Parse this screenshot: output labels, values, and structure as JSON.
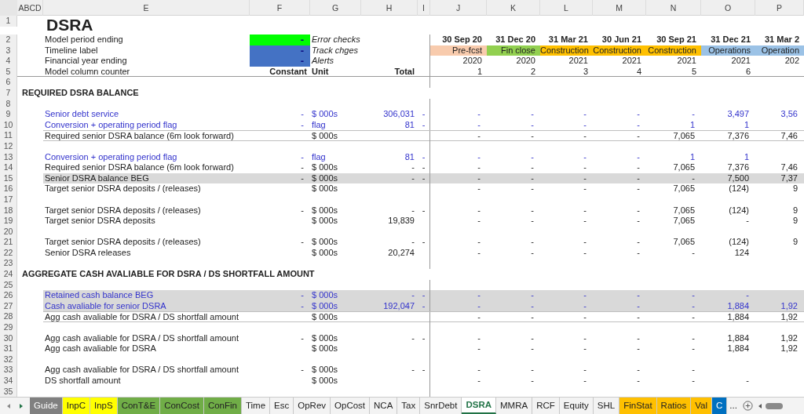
{
  "column_headers": [
    "ABCD",
    "E",
    "F",
    "G",
    "H",
    "I",
    "J",
    "K",
    "L",
    "M",
    "N",
    "O",
    "P"
  ],
  "title": {
    "row": "1",
    "text": "DSRA"
  },
  "meta_rows": [
    {
      "row": "2",
      "label": "Model period ending",
      "swatch": "-",
      "color": "#00ff00",
      "note": "Error checks"
    },
    {
      "row": "3",
      "label": "Timeline label",
      "swatch": "-",
      "color": "#4472c4",
      "note": "Track chges"
    },
    {
      "row": "4",
      "label": "Financial year ending",
      "swatch": "-",
      "color": "#4472c4",
      "note": "Alerts"
    }
  ],
  "periods": [
    {
      "date": "30 Sep 20",
      "phase": "Pre-fcst",
      "color": "#f8cbad",
      "year": "2020",
      "counter": "1"
    },
    {
      "date": "31 Dec 20",
      "phase": "Fin close",
      "color": "#92d050",
      "year": "2020",
      "counter": "2"
    },
    {
      "date": "31 Mar 21",
      "phase": "Construction",
      "color": "#ffc000",
      "year": "2021",
      "counter": "3"
    },
    {
      "date": "30 Jun 21",
      "phase": "Construction",
      "color": "#ffc000",
      "year": "2021",
      "counter": "4"
    },
    {
      "date": "30 Sep 21",
      "phase": "Construction",
      "color": "#ffc000",
      "year": "2021",
      "counter": "5"
    },
    {
      "date": "31 Dec 21",
      "phase": "Operations",
      "color": "#9bc2e6",
      "year": "2021",
      "counter": "6"
    },
    {
      "date": "31 Mar 2",
      "phase": "Operation",
      "color": "#9bc2e6",
      "year": "202"
    }
  ],
  "counter_row": {
    "row": "5",
    "label": "Model column counter",
    "constant": "Constant",
    "unit": "Unit",
    "total": "Total"
  },
  "rows": [
    {
      "row": "6",
      "kind": "blank"
    },
    {
      "row": "7",
      "kind": "section",
      "label": "REQUIRED DSRA BALANCE"
    },
    {
      "row": "8",
      "kind": "blank"
    },
    {
      "row": "9",
      "kind": "data",
      "input": true,
      "shaded": false,
      "ruled": false,
      "label": "Senior debt service",
      "constant": "-",
      "unit": "$ 000s",
      "total": "306,031",
      "check": "-",
      "cells": [
        "-",
        "-",
        "-",
        "-",
        "-",
        "3,497",
        "3,56"
      ]
    },
    {
      "row": "10",
      "kind": "data",
      "input": true,
      "shaded": false,
      "ruled": false,
      "label": "Conversion + operating period flag",
      "constant": "-",
      "unit": "flag",
      "total": "81",
      "check": "-",
      "cells": [
        "-",
        "-",
        "-",
        "-",
        "1",
        "1",
        ""
      ]
    },
    {
      "row": "11",
      "kind": "data",
      "input": false,
      "shaded": false,
      "ruled": true,
      "label": "Required senior DSRA balance (6m look forward)",
      "constant": "",
      "unit": "$ 000s",
      "total": "",
      "check": "",
      "cells": [
        "-",
        "-",
        "-",
        "-",
        "7,065",
        "7,376",
        "7,46"
      ]
    },
    {
      "row": "12",
      "kind": "blank"
    },
    {
      "row": "13",
      "kind": "data",
      "input": true,
      "shaded": false,
      "ruled": false,
      "label": "Conversion + operating period flag",
      "constant": "-",
      "unit": "flag",
      "total": "81",
      "check": "-",
      "cells": [
        "-",
        "-",
        "-",
        "-",
        "1",
        "1",
        ""
      ]
    },
    {
      "row": "14",
      "kind": "data",
      "input": false,
      "shaded": false,
      "ruled": false,
      "label": "Required senior DSRA balance (6m look forward)",
      "constant": "-",
      "unit": "$ 000s",
      "total": "-",
      "check": "-",
      "cells": [
        "-",
        "-",
        "-",
        "-",
        "7,065",
        "7,376",
        "7,46"
      ]
    },
    {
      "row": "15",
      "kind": "data",
      "input": false,
      "shaded": true,
      "ruled": false,
      "label": "Senior DSRA balance BEG",
      "constant": "-",
      "unit": "$ 000s",
      "total": "-",
      "check": "-",
      "cells": [
        "-",
        "-",
        "-",
        "-",
        "-",
        "7,500",
        "7,37"
      ]
    },
    {
      "row": "16",
      "kind": "data",
      "input": false,
      "shaded": false,
      "ruled": false,
      "label": "Target senior DSRA deposits / (releases)",
      "constant": "",
      "unit": "$ 000s",
      "total": "",
      "check": "",
      "cells": [
        "-",
        "-",
        "-",
        "-",
        "7,065",
        "(124)",
        "9"
      ]
    },
    {
      "row": "17",
      "kind": "blank"
    },
    {
      "row": "18",
      "kind": "data",
      "input": false,
      "shaded": false,
      "ruled": false,
      "label": "Target senior DSRA deposits / (releases)",
      "constant": "-",
      "unit": "$ 000s",
      "total": "-",
      "check": "-",
      "cells": [
        "-",
        "-",
        "-",
        "-",
        "7,065",
        "(124)",
        "9"
      ]
    },
    {
      "row": "19",
      "kind": "data",
      "input": false,
      "shaded": false,
      "ruled": false,
      "label": "Target senior DSRA deposits",
      "constant": "",
      "unit": "$ 000s",
      "total": "19,839",
      "check": "",
      "cells": [
        "-",
        "-",
        "-",
        "-",
        "7,065",
        "-",
        "9"
      ]
    },
    {
      "row": "20",
      "kind": "blank"
    },
    {
      "row": "21",
      "kind": "data",
      "input": false,
      "shaded": false,
      "ruled": false,
      "label": "Target senior DSRA deposits / (releases)",
      "constant": "-",
      "unit": "$ 000s",
      "total": "-",
      "check": "-",
      "cells": [
        "-",
        "-",
        "-",
        "-",
        "7,065",
        "(124)",
        "9"
      ]
    },
    {
      "row": "22",
      "kind": "data",
      "input": false,
      "shaded": false,
      "ruled": false,
      "label": "Senior DSRA releases",
      "constant": "",
      "unit": "$ 000s",
      "total": "20,274",
      "check": "",
      "cells": [
        "-",
        "-",
        "-",
        "-",
        "-",
        "124",
        ""
      ]
    },
    {
      "row": "23",
      "kind": "blank"
    },
    {
      "row": "24",
      "kind": "section",
      "label": "AGGREGATE CASH AVALIABLE FOR DSRA / DS SHORTFALL AMOUNT"
    },
    {
      "row": "25",
      "kind": "blank"
    },
    {
      "row": "26",
      "kind": "data",
      "input": true,
      "shaded": true,
      "ruled": false,
      "label": "Retained cash balance BEG",
      "constant": "-",
      "unit": "$ 000s",
      "total": "-",
      "check": "-",
      "cells": [
        "-",
        "-",
        "-",
        "-",
        "-",
        "-",
        ""
      ]
    },
    {
      "row": "27",
      "kind": "data",
      "input": true,
      "shaded": true,
      "ruled": false,
      "label": "Cash avaliable for senior DSRA",
      "constant": "-",
      "unit": "$ 000s",
      "total": "192,047",
      "check": "-",
      "cells": [
        "-",
        "-",
        "-",
        "-",
        "-",
        "1,884",
        "1,92"
      ]
    },
    {
      "row": "28",
      "kind": "data",
      "input": false,
      "shaded": false,
      "ruled": true,
      "label": "Agg cash avaliable for DSRA / DS shortfall amount",
      "constant": "",
      "unit": "$ 000s",
      "total": "",
      "check": "",
      "cells": [
        "-",
        "-",
        "-",
        "-",
        "-",
        "1,884",
        "1,92"
      ]
    },
    {
      "row": "29",
      "kind": "blank"
    },
    {
      "row": "30",
      "kind": "data",
      "input": false,
      "shaded": false,
      "ruled": false,
      "label": "Agg cash avaliable for DSRA / DS shortfall amount",
      "constant": "-",
      "unit": "$ 000s",
      "total": "-",
      "check": "-",
      "cells": [
        "-",
        "-",
        "-",
        "-",
        "-",
        "1,884",
        "1,92"
      ]
    },
    {
      "row": "31",
      "kind": "data",
      "input": false,
      "shaded": false,
      "ruled": false,
      "label": "Agg cash avaliable for DSRA",
      "constant": "",
      "unit": "$ 000s",
      "total": "",
      "check": "",
      "cells": [
        "-",
        "-",
        "-",
        "-",
        "-",
        "1,884",
        "1,92"
      ]
    },
    {
      "row": "32",
      "kind": "blank"
    },
    {
      "row": "33",
      "kind": "data",
      "input": false,
      "shaded": false,
      "ruled": false,
      "label": "Agg cash avaliable for DSRA / DS shortfall amount",
      "constant": "-",
      "unit": "$ 000s",
      "total": "-",
      "check": "-",
      "cells": [
        "-",
        "-",
        "-",
        "-",
        "-",
        "",
        ""
      ]
    },
    {
      "row": "34",
      "kind": "data",
      "input": false,
      "shaded": false,
      "ruled": false,
      "label": "DS shortfall amount",
      "constant": "",
      "unit": "$ 000s",
      "total": "",
      "check": "",
      "cells": [
        "-",
        "-",
        "-",
        "-",
        "-",
        "-",
        ""
      ]
    },
    {
      "row": "35",
      "kind": "blank"
    }
  ],
  "sheet_tabs": [
    {
      "label": "Guide",
      "color": "#808080",
      "selected": false
    },
    {
      "label": "InpC",
      "color": "#ffff00",
      "selected": false
    },
    {
      "label": "InpS",
      "color": "#ffff00",
      "selected": false
    },
    {
      "label": "ConT&E",
      "color": "#70ad47",
      "selected": false
    },
    {
      "label": "ConCost",
      "color": "#70ad47",
      "selected": false
    },
    {
      "label": "ConFin",
      "color": "#70ad47",
      "selected": false
    },
    {
      "label": "Time",
      "selected": false
    },
    {
      "label": "Esc",
      "selected": false
    },
    {
      "label": "OpRev",
      "selected": false
    },
    {
      "label": "OpCost",
      "selected": false
    },
    {
      "label": "NCA",
      "selected": false
    },
    {
      "label": "Tax",
      "selected": false
    },
    {
      "label": "SnrDebt",
      "selected": false
    },
    {
      "label": "DSRA",
      "selected": true
    },
    {
      "label": "MMRA",
      "selected": false
    },
    {
      "label": "RCF",
      "selected": false
    },
    {
      "label": "Equity",
      "selected": false
    },
    {
      "label": "SHL",
      "selected": false
    },
    {
      "label": "FinStat",
      "color": "#ffc000",
      "selected": false
    },
    {
      "label": "Ratios",
      "color": "#ffc000",
      "selected": false
    },
    {
      "label": "Val",
      "color": "#ffc000",
      "selected": false
    },
    {
      "label": "C",
      "color": "#0070c0",
      "selected": false
    }
  ],
  "more_tabs": "..."
}
